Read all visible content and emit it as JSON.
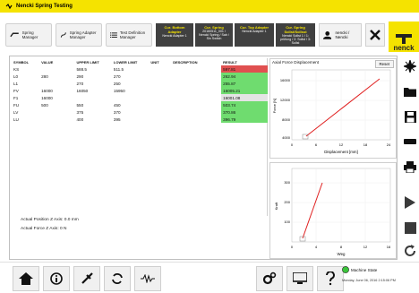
{
  "window": {
    "title": "Nencki Spring Testing"
  },
  "toolbar": {
    "spring_manager": "Spring Manager",
    "adapter_manager": "Spring Adapter Manager",
    "test_definition_manager": "Test Definition Manager",
    "info": [
      {
        "header": "Cur. Bottom Adapter",
        "value": "Nencki Adapter 1"
      },
      {
        "header": "Cur. Spring",
        "value": "20160511_001 / Nencki Spring / Sab / Sin Switch"
      },
      {
        "header": "Cur. Top Adapter",
        "value": "Nencki Adapter 1"
      },
      {
        "header": "Cur. Spring Sollst/Sollsst",
        "value": "Nencki Sollst 1 / 1: prüfung / 2: Sollst / 3: Sollst"
      }
    ],
    "user": "nencki / Nencki",
    "logo_text": "nenck"
  },
  "table": {
    "columns": [
      "SYMBOL",
      "VALUE",
      "UPPER LIMIT",
      "LOWER LIMIT",
      "UNIT",
      "DESCRIPTION",
      "RESULT"
    ],
    "rows": [
      {
        "symbol": "KS",
        "value": "",
        "upper": "588.5",
        "lower": "511.5",
        "unit": "",
        "desc": "",
        "result": "597.81",
        "status": "red"
      },
      {
        "symbol": "L0",
        "value": "280",
        "upper": "290",
        "lower": "270",
        "unit": "",
        "desc": "",
        "result": "262.94",
        "status": "green"
      },
      {
        "symbol": "L1",
        "value": "",
        "upper": "270",
        "lower": "250",
        "unit": "",
        "desc": "",
        "result": "255.87",
        "status": "green"
      },
      {
        "symbol": "FV",
        "value": "16000",
        "upper": "16050",
        "lower": "15950",
        "unit": "",
        "desc": "",
        "result": "16005.21",
        "status": "green"
      },
      {
        "symbol": "F1",
        "value": "16000",
        "upper": "",
        "lower": "",
        "unit": "",
        "desc": "",
        "result": "16001.08",
        "status": "grey"
      },
      {
        "symbol": "FU",
        "value": "500",
        "upper": "550",
        "lower": "450",
        "unit": "",
        "desc": "",
        "result": "503.74",
        "status": "green"
      },
      {
        "symbol": "LV",
        "value": "",
        "upper": "375",
        "lower": "370",
        "unit": "",
        "desc": "",
        "result": "370.86",
        "status": "green"
      },
      {
        "symbol": "LU",
        "value": "",
        "upper": "400",
        "lower": "395",
        "unit": "",
        "desc": "",
        "result": "396.79",
        "status": "green"
      }
    ]
  },
  "status": {
    "position": "Actual Position Z Axis: 0.0 mm",
    "force": "Actual Force Z Axis: 0 N"
  },
  "graph1": {
    "title": "Axial Force Displacement",
    "reset": "Reset",
    "xlabel": "Displacement [mm]",
    "ylabel": "Force [N]",
    "xticks": [
      "0",
      "6",
      "12",
      "18",
      "24"
    ],
    "yticks": [
      "16000",
      "12000",
      "8000",
      "4000"
    ],
    "line_color": "#e02020"
  },
  "graph2": {
    "xlabel": "Weg",
    "ylabel": "Kraft",
    "xticks": [
      "0",
      "4",
      "8",
      "12",
      "16"
    ],
    "yticks": [
      "300",
      "200",
      "100"
    ],
    "line_color": "#e02020"
  },
  "bottom": {
    "machine_state_label": "Machine State",
    "datetime": "Monday, June 06, 2016  2:15:06 PM",
    "state_color": "#3cc43c"
  },
  "colors": {
    "accent": "#f5e300",
    "dark": "#404040"
  }
}
